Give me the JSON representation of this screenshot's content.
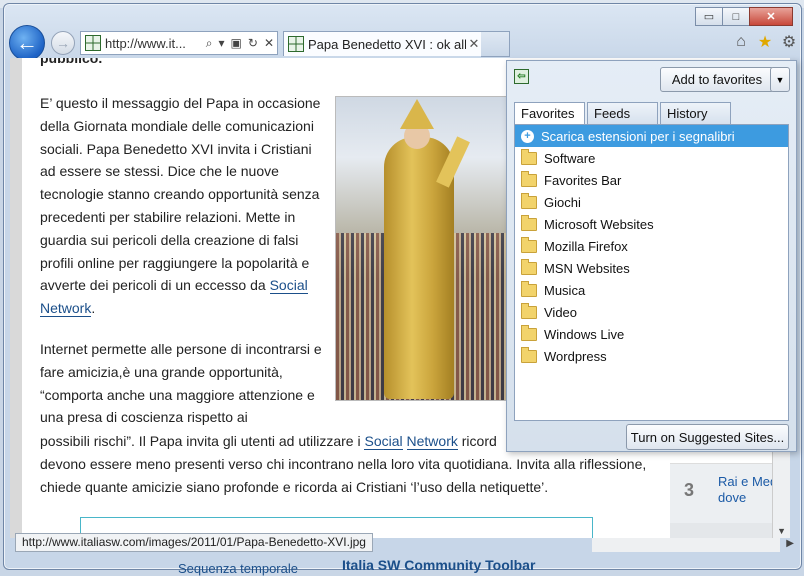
{
  "window": {
    "caption_min": "▭",
    "caption_max": "□",
    "caption_close": "✕"
  },
  "nav": {
    "back_glyph": "←",
    "forward_glyph": "→",
    "address_url": "http://www.it...",
    "address_icons": [
      "⌕",
      "▾",
      "▣",
      "↻",
      "✕"
    ],
    "tab_title": "Papa Benedetto XVI : ok all'...",
    "tab_close": "✕",
    "tool_icons": [
      "home-icon",
      "favorites-star-icon",
      "gear-icon"
    ]
  },
  "article": {
    "top_bold": "pubblico.",
    "p1": "E’ questo il messaggio del Papa in occasione della Giornata mondiale delle comunicazioni sociali. Papa Benedetto XVI invita i Cristiani ad essere se stessi. Dice che le nuove tecnologie stanno creando opportunità senza precedenti per stabilire relazioni. Mette in guardia sui pericoli della creazione di falsi profili online per raggiungere la popolarità e avverte dei pericoli di un eccesso da ",
    "p1_link1": "Social",
    "p1_link2": "Network",
    "p1_end": ".",
    "p2": "Internet permette alle persone di incontrarsi e fare amicizia,è una grande opportunità, “comporta anche una maggiore attenzione e una presa di coscienza rispetto ai",
    "p2b_start": "possibili rischi”. Il Papa invita gli utenti ad utilizzare i ",
    "p2b_link1": "Social",
    "p2b_link2": "Network",
    "p2b_rest": " ricord",
    "p2b_line2": "devono essere meno presenti verso chi incontrano nella loro vita quotidiana. Invita alla riflessione, chiede quante amicizie siano profonde e ricorda ai Cristiani ‘l’uso della netiquette’."
  },
  "sidebar_ad": {
    "number": "3",
    "text": "Rai e Med dove"
  },
  "favorites_panel": {
    "add_button": "Add to favorites",
    "tabs": [
      "Favorites",
      "Feeds",
      "History"
    ],
    "items": [
      {
        "label": "Scarica estensioni per i segnalibri",
        "type": "special",
        "selected": true
      },
      {
        "label": "Software",
        "type": "folder"
      },
      {
        "label": "Favorites Bar",
        "type": "folder"
      },
      {
        "label": "Giochi",
        "type": "folder"
      },
      {
        "label": "Microsoft Websites",
        "type": "folder"
      },
      {
        "label": "Mozilla Firefox",
        "type": "folder"
      },
      {
        "label": "MSN Websites",
        "type": "folder"
      },
      {
        "label": "Musica",
        "type": "folder"
      },
      {
        "label": "Video",
        "type": "folder"
      },
      {
        "label": "Windows Live",
        "type": "folder"
      },
      {
        "label": "Wordpress",
        "type": "folder"
      }
    ],
    "suggested_button": "Turn on Suggested Sites..."
  },
  "status": {
    "url": "http://www.italiasw.com/images/2011/01/Papa-Benedetto-XVI.jpg"
  },
  "below": {
    "link1": "Sequenza temporale",
    "link2": "Italia SW Community Toolbar"
  }
}
